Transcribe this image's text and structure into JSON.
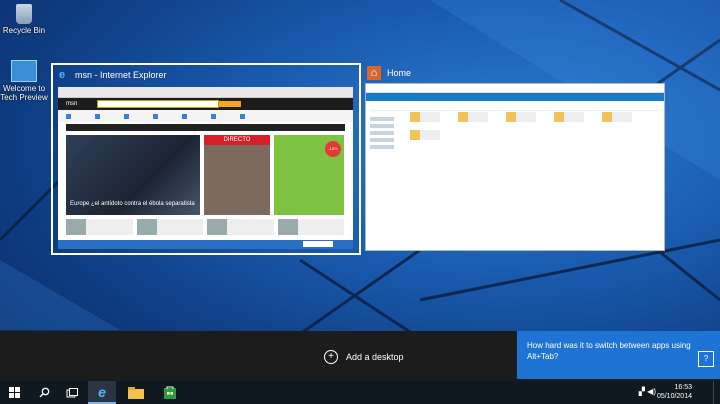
{
  "desktop": {
    "icons": [
      {
        "label": "Recycle Bin"
      },
      {
        "label": "Welcome to Tech Preview"
      }
    ]
  },
  "task_view": {
    "windows": [
      {
        "title": "msn - Internet Explorer",
        "icon": "internet-explorer-icon",
        "selected": true,
        "page": {
          "brand": "msn",
          "headline": "Europe ¿el antídoto contra el ébola separatista",
          "live_label": "DIRECTO",
          "ad_badge": "-10%"
        }
      },
      {
        "title": "Home",
        "icon": "home-folder-icon",
        "selected": false
      }
    ]
  },
  "virtual_desktops": {
    "add_label": "Add a desktop"
  },
  "feedback": {
    "question": "How hard was it to switch between apps using Alt+Tab?",
    "accent": "#1e74d4"
  },
  "taskbar": {
    "buttons": [
      "start-icon",
      "search-icon",
      "task-view-icon",
      "internet-explorer-icon",
      "file-explorer-icon",
      "store-icon"
    ],
    "clock": {
      "time": "16:53",
      "date": "05/10/2014"
    }
  }
}
